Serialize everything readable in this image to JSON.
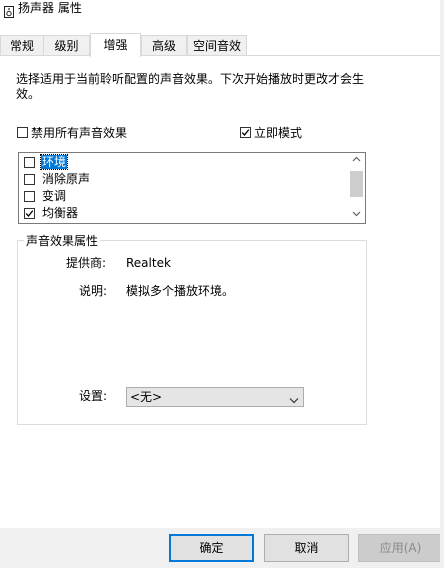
{
  "window": {
    "title": "扬声器 属性"
  },
  "tabs": [
    {
      "label": "常规",
      "active": false
    },
    {
      "label": "级别",
      "active": false
    },
    {
      "label": "增强",
      "active": true
    },
    {
      "label": "高级",
      "active": false
    },
    {
      "label": "空间音效",
      "active": false
    }
  ],
  "enhancements": {
    "description": "选择适用于当前聆听配置的声音效果。下次开始播放时更改才会生效。",
    "disable_all": {
      "label": "禁用所有声音效果",
      "checked": false
    },
    "immediate_mode": {
      "label": "立即模式",
      "checked": true
    },
    "effects": [
      {
        "label": "环境",
        "checked": false,
        "selected": true
      },
      {
        "label": "消除原声",
        "checked": false,
        "selected": false
      },
      {
        "label": "变调",
        "checked": false,
        "selected": false
      },
      {
        "label": "均衡器",
        "checked": true,
        "selected": false
      }
    ]
  },
  "properties": {
    "group_title": "声音效果属性",
    "provider_label": "提供商:",
    "provider_value": "Realtek",
    "description_label": "说明:",
    "description_value": "模拟多个播放环境。",
    "settings_label": "设置:",
    "settings_value": "<无>"
  },
  "buttons": {
    "ok": "确定",
    "cancel": "取消",
    "apply": "应用(A)"
  }
}
